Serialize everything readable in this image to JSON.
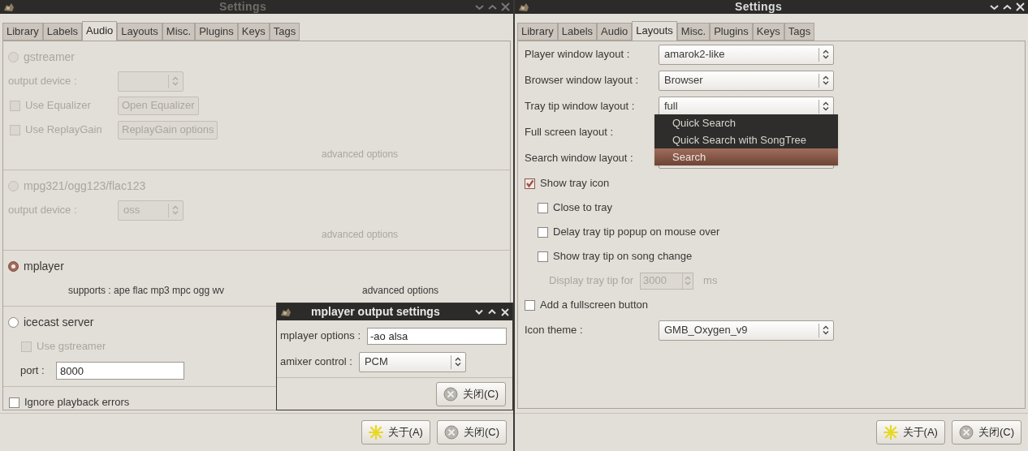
{
  "audio_window": {
    "title": "Settings",
    "active": false,
    "tabs": [
      {
        "label": "Library",
        "selected": false
      },
      {
        "label": "Labels",
        "selected": false
      },
      {
        "label": "Audio",
        "selected": true
      },
      {
        "label": "Layouts",
        "selected": false
      },
      {
        "label": "Misc.",
        "selected": false
      },
      {
        "label": "Plugins",
        "selected": false
      },
      {
        "label": "Keys",
        "selected": false
      },
      {
        "label": "Tags",
        "selected": false
      }
    ],
    "sections": [
      {
        "items": [
          {
            "kind": "radio",
            "label": "gstreamer",
            "selected": false,
            "disabled": true
          },
          {
            "kind": "combo",
            "label": "output device :",
            "disabled": true
          },
          {
            "kind": "check_button",
            "label": "Use Equalizer",
            "checked": false,
            "button": "Open Equalizer",
            "disabled": true
          },
          {
            "kind": "check_button",
            "label": "Use ReplayGain",
            "checked": false,
            "button": "ReplayGain options",
            "disabled": true
          },
          {
            "kind": "link",
            "label": "advanced options",
            "disabled": true
          }
        ]
      },
      {
        "items": [
          {
            "kind": "radio",
            "label": "mpg321/ogg123/flac123",
            "selected": false,
            "disabled": true
          },
          {
            "kind": "combo",
            "label": "output device :",
            "value": "oss",
            "disabled": true
          },
          {
            "kind": "link",
            "label": "advanced options",
            "disabled": true
          }
        ]
      },
      {
        "items": [
          {
            "kind": "radio",
            "label": "mplayer",
            "selected": true,
            "disabled": false
          },
          {
            "kind": "info",
            "text": "supports : ape flac mp3 mpc ogg wv",
            "link": "advanced options",
            "disabled": false
          }
        ]
      },
      {
        "items": [
          {
            "kind": "radio",
            "label": "icecast server",
            "selected": false,
            "disabled": false
          },
          {
            "kind": "checkbox",
            "label": "Use gstreamer",
            "checked": false,
            "disabled": true
          },
          {
            "kind": "field",
            "label": "port :",
            "value": "8000",
            "disabled": false
          }
        ]
      },
      {
        "items": [
          {
            "kind": "section_checkbox",
            "label": "Ignore playback errors",
            "checked": false,
            "disabled": false
          }
        ]
      }
    ],
    "buttons": [
      {
        "kind": "about",
        "label": "关于(A)"
      },
      {
        "kind": "close",
        "label": "关闭(C)"
      }
    ],
    "dialog": {
      "title": "mplayer output settings",
      "fields": [
        {
          "kind": "text",
          "label": "mplayer options :",
          "value": "-ao alsa"
        },
        {
          "kind": "combo",
          "label": "amixer control :",
          "value": "PCM"
        }
      ],
      "button": {
        "kind": "close",
        "label": "关闭(C)"
      }
    }
  },
  "layouts_window": {
    "title": "Settings",
    "active": true,
    "tabs": [
      {
        "label": "Library",
        "selected": false
      },
      {
        "label": "Labels",
        "selected": false
      },
      {
        "label": "Audio",
        "selected": false
      },
      {
        "label": "Layouts",
        "selected": true
      },
      {
        "label": "Misc.",
        "selected": false
      },
      {
        "label": "Plugins",
        "selected": false
      },
      {
        "label": "Keys",
        "selected": false
      },
      {
        "label": "Tags",
        "selected": false
      }
    ],
    "rows": [
      {
        "kind": "combo",
        "label": "Player window layout :",
        "value": "amarok2-like"
      },
      {
        "kind": "combo",
        "label": "Browser window layout :",
        "value": "Browser"
      },
      {
        "kind": "combo",
        "label": "Tray tip window layout :",
        "value": "full"
      },
      {
        "kind": "label",
        "label": "Full screen layout :"
      },
      {
        "kind": "combo",
        "label": "Search window layout :"
      },
      {
        "kind": "checkbox",
        "label": "Show tray icon",
        "checked": true,
        "disabled": false,
        "children": [
          {
            "kind": "checkbox",
            "label": "Close to tray",
            "checked": false,
            "disabled": false
          },
          {
            "kind": "checkbox",
            "label": "Delay tray tip popup on mouse over",
            "checked": false,
            "disabled": false
          },
          {
            "kind": "checkbox",
            "label": "Show tray tip on song change",
            "checked": false,
            "disabled": false,
            "children": [
              {
                "kind": "spin",
                "label": "Display tray tip for",
                "value": "3000",
                "unit": "ms",
                "disabled": true
              }
            ]
          }
        ]
      },
      {
        "kind": "checkbox",
        "label": "Add a fullscreen button",
        "checked": false,
        "disabled": false
      },
      {
        "kind": "combo",
        "label": "Icon theme :",
        "value": "GMB_Oxygen_v9"
      }
    ],
    "dropdown_menu": {
      "items": [
        {
          "label": "Quick Search",
          "selected": false
        },
        {
          "label": "Quick Search with SongTree",
          "selected": false
        },
        {
          "label": "Search",
          "selected": true
        }
      ]
    },
    "buttons": [
      {
        "kind": "about",
        "label": "关于(A)"
      },
      {
        "kind": "close",
        "label": "关闭(C)"
      }
    ]
  }
}
